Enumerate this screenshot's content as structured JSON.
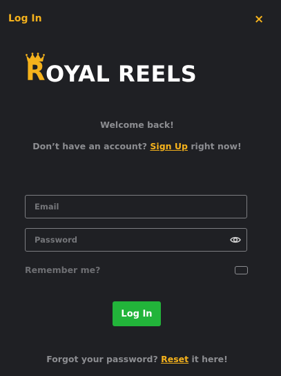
{
  "header": {
    "title": "Log In",
    "close_glyph": "×"
  },
  "logo": {
    "first_letter": "R",
    "rest": "OYAL REELS",
    "accent_color": "#f5b21c",
    "icon": "crown-icon"
  },
  "welcome": "Welcome back!",
  "signup": {
    "prefix": "Don’t have an account?",
    "link": "Sign Up",
    "suffix": "right now!"
  },
  "form": {
    "email_placeholder": "Email",
    "password_placeholder": "Password",
    "password_icon": "eye-icon",
    "remember_label": "Remember me?",
    "remember_checked": false,
    "submit_label": "Log In",
    "submit_color": "#22b43a"
  },
  "forgot": {
    "prefix": "Forgot your password?",
    "link": "Reset",
    "suffix": "it here!"
  }
}
